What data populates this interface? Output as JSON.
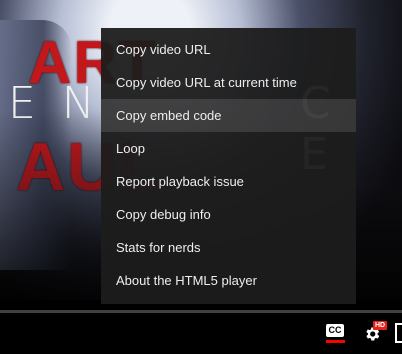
{
  "context_menu": {
    "items": [
      {
        "label": "Copy video URL"
      },
      {
        "label": "Copy video URL at current time"
      },
      {
        "label": "Copy embed code"
      },
      {
        "label": "Loop"
      },
      {
        "label": "Report playback issue"
      },
      {
        "label": "Copy debug info"
      },
      {
        "label": "Stats for nerds"
      },
      {
        "label": "About the HTML5 player"
      }
    ]
  },
  "controls": {
    "cc_label": "CC",
    "hd_badge": "HD",
    "cc_icon": "closed-captions-icon",
    "settings_icon": "gear-icon",
    "fullscreen_icon": "fullscreen-icon",
    "accent_color": "#ff0000"
  }
}
